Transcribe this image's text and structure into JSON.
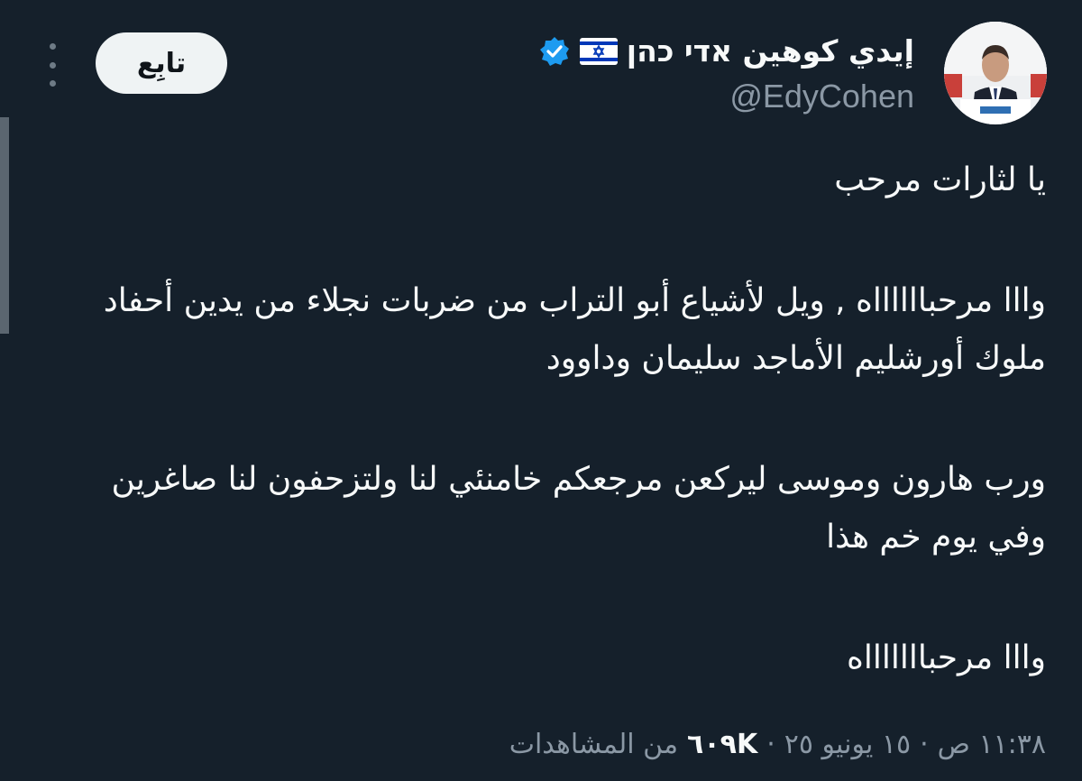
{
  "author": {
    "display_name": "إيدي كوهين אדי כהן",
    "handle": "@EdyCohen",
    "flag": "israel-flag-icon",
    "verified": "verified-badge-icon"
  },
  "actions": {
    "follow_label": "تابِع",
    "more": "more-options-icon"
  },
  "tweet": {
    "lines": [
      "يا لثارات مرحب",
      "وااا مرحبااااااه , ويل لأشياع أبو التراب من ضربات نجلاء من يدين أحفاد ملوك أورشليم الأماجد سليمان وداوود",
      "ورب هارون وموسى ليركعن مرجعكم خامنئي لنا ولتزحفون لنا صاغرين وفي يوم خم هذا",
      "وااا مرحباااااااه"
    ]
  },
  "meta": {
    "time": "١١:٣٨ ص",
    "date": "١٥ يونيو ٢٥",
    "separator": "·",
    "views_count": "٦٠٩K",
    "views_label": "من المشاهدات"
  },
  "colors": {
    "background": "#15202b",
    "text": "#f7f9f9",
    "secondary": "#8b98a5",
    "verified": "#1d9bf0",
    "follow_bg": "#eff3f4"
  }
}
